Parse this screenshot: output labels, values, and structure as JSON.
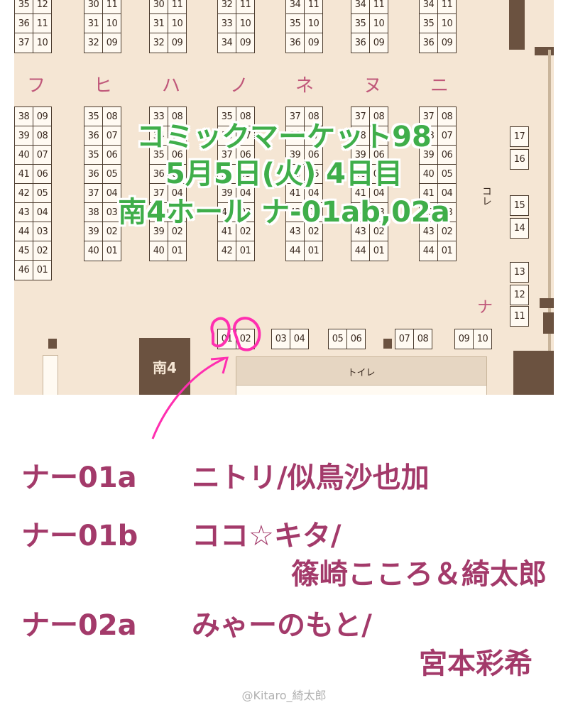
{
  "title": {
    "line1": "コミックマーケット98",
    "line2": "5月5日(火) 4日目",
    "line3": "南4ホール ナ-01ab,02a"
  },
  "map": {
    "column_labels": [
      "フ",
      "ヒ",
      "ハ",
      "ノ",
      "ネ",
      "ヌ",
      "ニ"
    ],
    "na_label": "ナ",
    "hall_label": "南4",
    "toilet_label": "トイレ",
    "side_label": "コレ",
    "top_blocks": [
      [
        [
          "35",
          "12"
        ],
        [
          "36",
          "11"
        ],
        [
          "37",
          "10"
        ]
      ],
      [
        [
          "30",
          "11"
        ],
        [
          "31",
          "10"
        ],
        [
          "32",
          "09"
        ]
      ],
      [
        [
          "30",
          "11"
        ],
        [
          "31",
          "10"
        ],
        [
          "32",
          "09"
        ]
      ],
      [
        [
          "32",
          "11"
        ],
        [
          "33",
          "10"
        ],
        [
          "34",
          "09"
        ]
      ],
      [
        [
          "34",
          "11"
        ],
        [
          "35",
          "10"
        ],
        [
          "36",
          "09"
        ]
      ],
      [
        [
          "34",
          "11"
        ],
        [
          "35",
          "10"
        ],
        [
          "36",
          "09"
        ]
      ],
      [
        [
          "34",
          "11"
        ],
        [
          "35",
          "10"
        ],
        [
          "36",
          "09"
        ]
      ]
    ],
    "fu_column": [
      [
        "38",
        "09"
      ],
      [
        "39",
        "08"
      ],
      [
        "40",
        "07"
      ],
      [
        "41",
        "06"
      ],
      [
        "42",
        "05"
      ],
      [
        "43",
        "04"
      ],
      [
        "44",
        "03"
      ],
      [
        "45",
        "02"
      ],
      [
        "46",
        "01"
      ]
    ],
    "mid_columns": [
      [
        [
          "35",
          "08"
        ],
        [
          "36",
          "07"
        ],
        [
          "35",
          "06"
        ],
        [
          "36",
          "05"
        ],
        [
          "37",
          "04"
        ],
        [
          "38",
          "03"
        ],
        [
          "39",
          "02"
        ],
        [
          "40",
          "01"
        ]
      ],
      [
        [
          "33",
          "08"
        ],
        [
          "34",
          "07"
        ],
        [
          "35",
          "06"
        ],
        [
          "36",
          "05"
        ],
        [
          "37",
          "04"
        ],
        [
          "38",
          "03"
        ],
        [
          "39",
          "02"
        ],
        [
          "40",
          "01"
        ]
      ],
      [
        [
          "35",
          "08"
        ],
        [
          "36",
          "07"
        ],
        [
          "37",
          "06"
        ],
        [
          "38",
          "05"
        ],
        [
          "39",
          "04"
        ],
        [
          "40",
          "03"
        ],
        [
          "41",
          "02"
        ],
        [
          "42",
          "01"
        ]
      ],
      [
        [
          "37",
          "08"
        ],
        [
          "38",
          "07"
        ],
        [
          "39",
          "06"
        ],
        [
          "40",
          "05"
        ],
        [
          "41",
          "04"
        ],
        [
          "42",
          "03"
        ],
        [
          "43",
          "02"
        ],
        [
          "44",
          "01"
        ]
      ],
      [
        [
          "37",
          "08"
        ],
        [
          "38",
          "07"
        ],
        [
          "39",
          "06"
        ],
        [
          "40",
          "05"
        ],
        [
          "41",
          "04"
        ],
        [
          "42",
          "03"
        ],
        [
          "43",
          "02"
        ],
        [
          "44",
          "01"
        ]
      ],
      [
        [
          "37",
          "08"
        ],
        [
          "38",
          "07"
        ],
        [
          "39",
          "06"
        ],
        [
          "40",
          "05"
        ],
        [
          "41",
          "04"
        ],
        [
          "42",
          "03"
        ],
        [
          "43",
          "02"
        ],
        [
          "44",
          "01"
        ]
      ]
    ],
    "right_column": [
      "17",
      "16",
      "15",
      "14",
      "13",
      "12",
      "11"
    ],
    "bottom_row": [
      "01",
      "02",
      "03",
      "04",
      "05",
      "06",
      "07",
      "08",
      "09",
      "10"
    ]
  },
  "entries": [
    {
      "code": "ナー01a",
      "name": "ニトリ/似鳥沙也加",
      "name2": ""
    },
    {
      "code": "ナー01b",
      "name": "ココ☆キタ/",
      "name2": "篠崎こころ＆綺太郎"
    },
    {
      "code": "ナー02a",
      "name": "みゃーのもと/",
      "name2": "宮本彩希"
    }
  ],
  "watermark": "@Kitaro_綺太郎",
  "colors": {
    "map_bg": "#f5e6d4",
    "title_green": "#3fae4a",
    "entry_text": "#a33a6a",
    "circle_pink": "#ff2fb0",
    "label_pink": "#c0587a"
  }
}
